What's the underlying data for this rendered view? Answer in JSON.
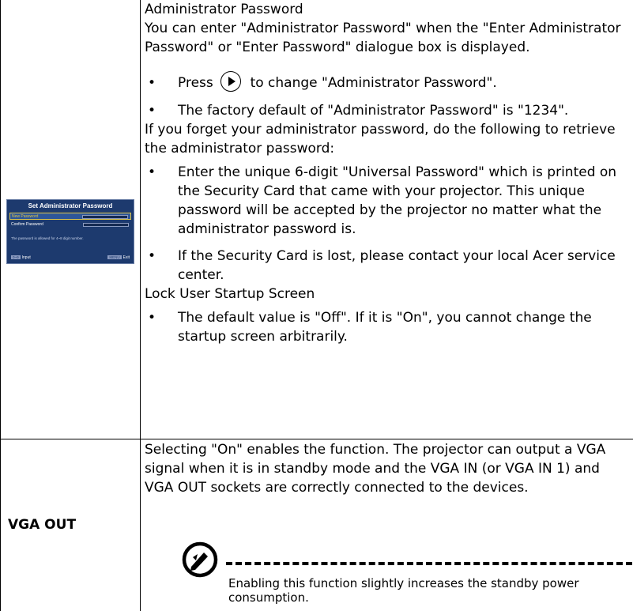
{
  "row1": {
    "heading_admin": "Administrator Password",
    "intro": "You can enter \"Administrator Password\" when the \"Enter Administrator Password\" or \"Enter Password\" dialogue box is displayed.",
    "bullet_press_before": "Press",
    "bullet_press_after": "to change \"Administrator Password\".",
    "bullet_default": "The factory default of \"Administrator Password\" is \"1234\".",
    "forget": "If you forget your administrator password, do the following to retrieve the administrator password:",
    "bullet_universal": "Enter the unique 6-digit \"Universal Password\" which is printed on the Security Card that came with your projector. This unique password will be accepted by the projector no matter what the administrator password is.",
    "bullet_lost": "If the Security Card is lost, please contact your local Acer service center.",
    "heading_lock": "Lock User Startup Screen",
    "bullet_lock": "The default value is \"Off\". If it is \"On\", you cannot change the startup screen arbitrarily.",
    "bullet_glyph": "•"
  },
  "osd": {
    "title": "Set Administrator Password",
    "row_new": "New Password",
    "row_confirm": "Confirm Password",
    "note": "The password is allowed for 4~8 digit number.",
    "foot_left": "Input",
    "foot_right": "Exit",
    "key_left": "0~9",
    "key_right": "MENU"
  },
  "row2": {
    "label": "VGA OUT",
    "description": "Selecting \"On\" enables the function. The projector can output a VGA signal when it is in standby mode and the VGA IN (or VGA IN 1) and VGA OUT sockets are correctly connected to the devices.",
    "note": "Enabling this function slightly increases the standby power consumption."
  }
}
